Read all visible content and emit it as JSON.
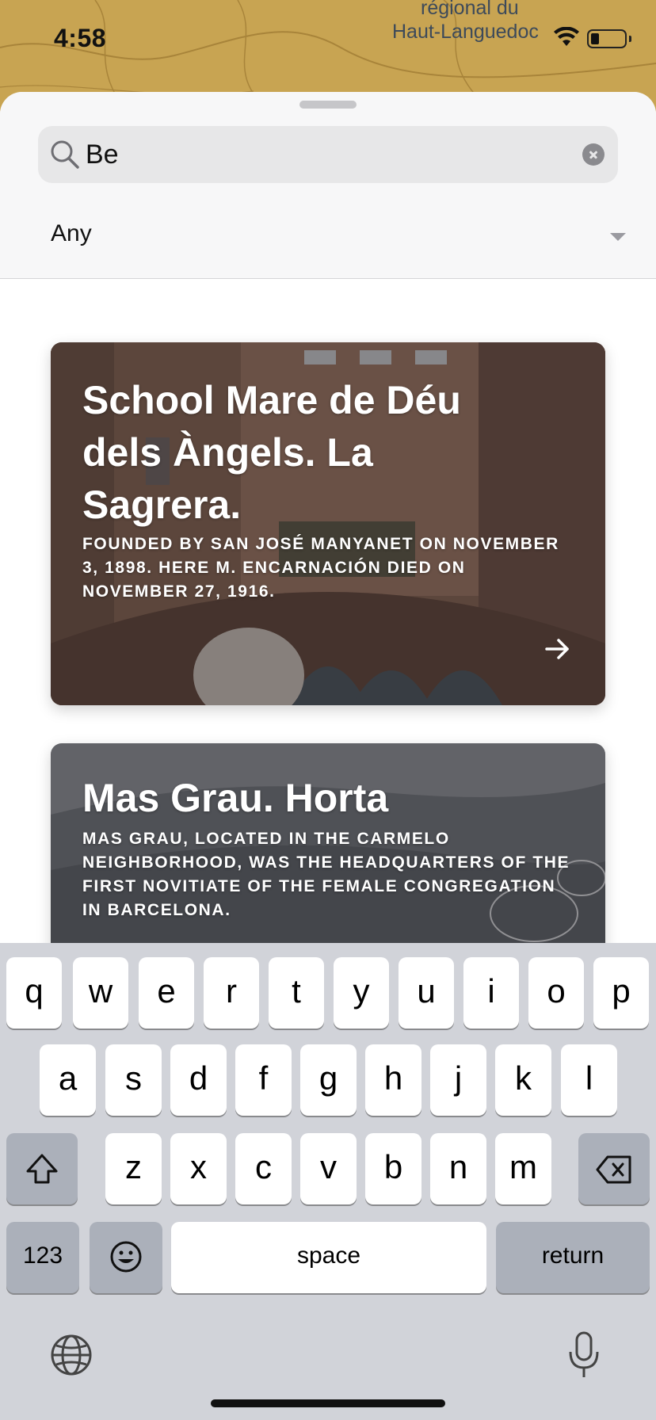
{
  "status_bar": {
    "time": "4:58"
  },
  "map": {
    "labels": [
      "régional du",
      "Haut-Languedoc"
    ]
  },
  "search": {
    "value": "Be",
    "clear_icon": "clear-circle-icon"
  },
  "filter": {
    "value": "Any"
  },
  "cards": [
    {
      "title": "School Mare de Déu dels Àngels. La Sagrera.",
      "description": "FOUNDED BY SAN JOSÉ MANYANET ON NOVEMBER 3, 1898. HERE M. ENCARNACIÓN DIED ON NOVEMBER 27, 1916."
    },
    {
      "title": "Mas Grau. Horta",
      "description": "MAS GRAU, LOCATED IN THE CARMELO NEIGHBORHOOD, WAS THE HEADQUARTERS OF THE FIRST NOVITIATE OF THE FEMALE CONGREGATION IN BARCELONA."
    }
  ],
  "keyboard": {
    "row1": [
      "q",
      "w",
      "e",
      "r",
      "t",
      "y",
      "u",
      "i",
      "o",
      "p"
    ],
    "row2": [
      "a",
      "s",
      "d",
      "f",
      "g",
      "h",
      "j",
      "k",
      "l"
    ],
    "row3": [
      "z",
      "x",
      "c",
      "v",
      "b",
      "n",
      "m"
    ],
    "numbers_label": "123",
    "space_label": "space",
    "return_label": "return"
  }
}
